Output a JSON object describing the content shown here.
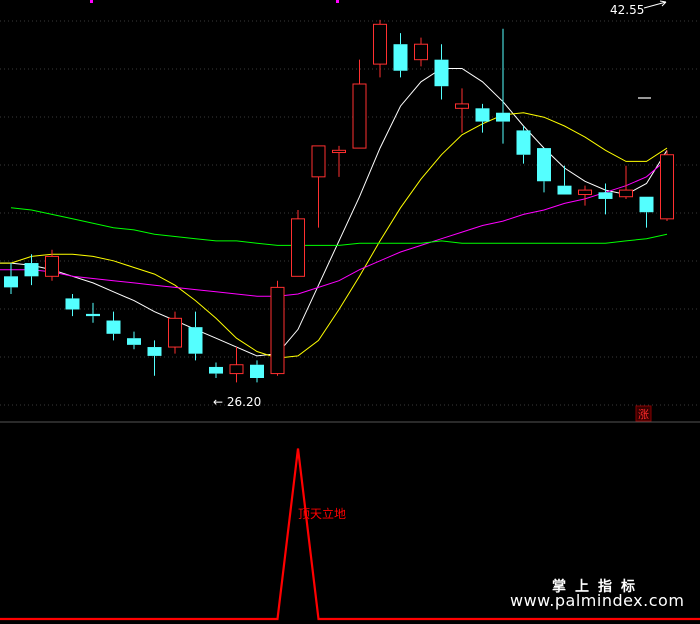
{
  "chart_data": [
    {
      "type": "candlestick",
      "panel": "price",
      "ylim": [
        24.5,
        43.5
      ],
      "grid": true,
      "annotations": {
        "high_label": "42.55",
        "low_label": "← 26.20",
        "rise_badge": "涨"
      },
      "candles": [
        {
          "o": 31.0,
          "h": 31.6,
          "l": 30.2,
          "c": 30.5
        },
        {
          "o": 31.6,
          "h": 32.0,
          "l": 30.6,
          "c": 31.0
        },
        {
          "o": 31.0,
          "h": 32.2,
          "l": 30.8,
          "c": 31.9
        },
        {
          "o": 30.0,
          "h": 30.2,
          "l": 29.2,
          "c": 29.5
        },
        {
          "o": 29.3,
          "h": 29.8,
          "l": 28.9,
          "c": 29.2
        },
        {
          "o": 29.0,
          "h": 29.4,
          "l": 28.1,
          "c": 28.4
        },
        {
          "o": 28.2,
          "h": 28.5,
          "l": 27.7,
          "c": 27.9
        },
        {
          "o": 27.8,
          "h": 28.1,
          "l": 26.5,
          "c": 27.4
        },
        {
          "o": 27.8,
          "h": 29.4,
          "l": 27.5,
          "c": 29.1
        },
        {
          "o": 28.7,
          "h": 29.4,
          "l": 27.2,
          "c": 27.5
        },
        {
          "o": 26.9,
          "h": 27.1,
          "l": 26.4,
          "c": 26.6
        },
        {
          "o": 26.6,
          "h": 27.8,
          "l": 26.2,
          "c": 27.0
        },
        {
          "o": 27.0,
          "h": 27.2,
          "l": 26.2,
          "c": 26.4
        },
        {
          "o": 26.6,
          "h": 30.8,
          "l": 26.5,
          "c": 30.5
        },
        {
          "o": 31.0,
          "h": 34.0,
          "l": 31.0,
          "c": 33.6
        },
        {
          "o": 35.5,
          "h": 36.7,
          "l": 33.2,
          "c": 36.9
        },
        {
          "o": 36.6,
          "h": 36.9,
          "l": 35.5,
          "c": 36.7
        },
        {
          "o": 36.8,
          "h": 40.8,
          "l": 36.8,
          "c": 39.7
        },
        {
          "o": 40.6,
          "h": 42.6,
          "l": 40.0,
          "c": 42.4
        },
        {
          "o": 41.5,
          "h": 42.0,
          "l": 40.0,
          "c": 40.3
        },
        {
          "o": 40.8,
          "h": 41.8,
          "l": 40.5,
          "c": 41.5
        },
        {
          "o": 40.8,
          "h": 41.5,
          "l": 39.0,
          "c": 39.6
        },
        {
          "o": 38.6,
          "h": 39.5,
          "l": 37.5,
          "c": 38.8
        },
        {
          "o": 38.6,
          "h": 38.8,
          "l": 37.5,
          "c": 38.0
        },
        {
          "o": 38.4,
          "h": 42.2,
          "l": 37.0,
          "c": 38.0
        },
        {
          "o": 37.6,
          "h": 37.8,
          "l": 36.1,
          "c": 36.5
        },
        {
          "o": 36.8,
          "h": 36.8,
          "l": 34.8,
          "c": 35.3
        },
        {
          "o": 35.1,
          "h": 36.0,
          "l": 34.8,
          "c": 34.7
        },
        {
          "o": 34.7,
          "h": 35.1,
          "l": 34.2,
          "c": 34.9
        },
        {
          "o": 34.8,
          "h": 35.2,
          "l": 33.8,
          "c": 34.5
        },
        {
          "o": 34.6,
          "h": 36.0,
          "l": 34.5,
          "c": 34.9
        },
        {
          "o": 34.6,
          "h": 34.6,
          "l": 33.2,
          "c": 33.9
        },
        {
          "o": 33.6,
          "h": 36.7,
          "l": 33.5,
          "c": 36.5
        }
      ],
      "series": [
        {
          "color": "#ffffff",
          "values": [
            31.6,
            31.5,
            31.3,
            31.0,
            30.7,
            30.3,
            29.9,
            29.4,
            29.0,
            28.6,
            28.2,
            27.8,
            27.4,
            27.5,
            28.6,
            30.6,
            32.6,
            34.6,
            36.8,
            38.7,
            39.8,
            40.4,
            40.4,
            39.8,
            38.9,
            37.8,
            36.8,
            35.9,
            35.3,
            34.9,
            34.7,
            35.2,
            36.7
          ]
        },
        {
          "color": "#ffff00",
          "values": [
            31.6,
            31.9,
            32.0,
            32.0,
            31.9,
            31.7,
            31.4,
            31.1,
            30.6,
            29.9,
            29.1,
            28.2,
            27.6,
            27.3,
            27.4,
            28.1,
            29.5,
            31.0,
            32.6,
            34.1,
            35.4,
            36.5,
            37.4,
            37.9,
            38.3,
            38.4,
            38.2,
            37.8,
            37.3,
            36.7,
            36.2,
            36.2,
            36.8
          ]
        },
        {
          "color": "#ff00ff",
          "values": [
            31.3,
            31.3,
            31.2,
            31.0,
            30.9,
            30.8,
            30.7,
            30.6,
            30.5,
            30.4,
            30.3,
            30.2,
            30.1,
            30.1,
            30.2,
            30.5,
            30.8,
            31.3,
            31.7,
            32.1,
            32.4,
            32.7,
            33.0,
            33.3,
            33.5,
            33.8,
            34.0,
            34.3,
            34.5,
            34.8,
            35.1,
            35.5,
            36.3
          ]
        },
        {
          "color": "#00ff00",
          "values": [
            34.1,
            34.0,
            33.8,
            33.6,
            33.4,
            33.2,
            33.1,
            32.9,
            32.8,
            32.7,
            32.6,
            32.6,
            32.5,
            32.4,
            32.4,
            32.4,
            32.4,
            32.5,
            32.5,
            32.5,
            32.5,
            32.6,
            32.5,
            32.5,
            32.5,
            32.5,
            32.5,
            32.5,
            32.5,
            32.5,
            32.6,
            32.7,
            32.9
          ]
        }
      ]
    },
    {
      "type": "line",
      "panel": "indicator",
      "ylim": [
        0,
        1.05
      ],
      "series": [
        {
          "color": "#ff0000",
          "label": "顶天立地",
          "values": [
            0,
            0,
            0,
            0,
            0,
            0,
            0,
            0,
            0,
            0,
            0,
            0,
            0,
            0,
            1,
            0,
            0,
            0,
            0,
            0,
            0,
            0,
            0,
            0,
            0,
            0,
            0,
            0,
            0,
            0,
            0,
            0,
            0
          ]
        }
      ]
    }
  ],
  "watermark": {
    "name": "掌上指标",
    "url": "www.palmindex.com"
  }
}
